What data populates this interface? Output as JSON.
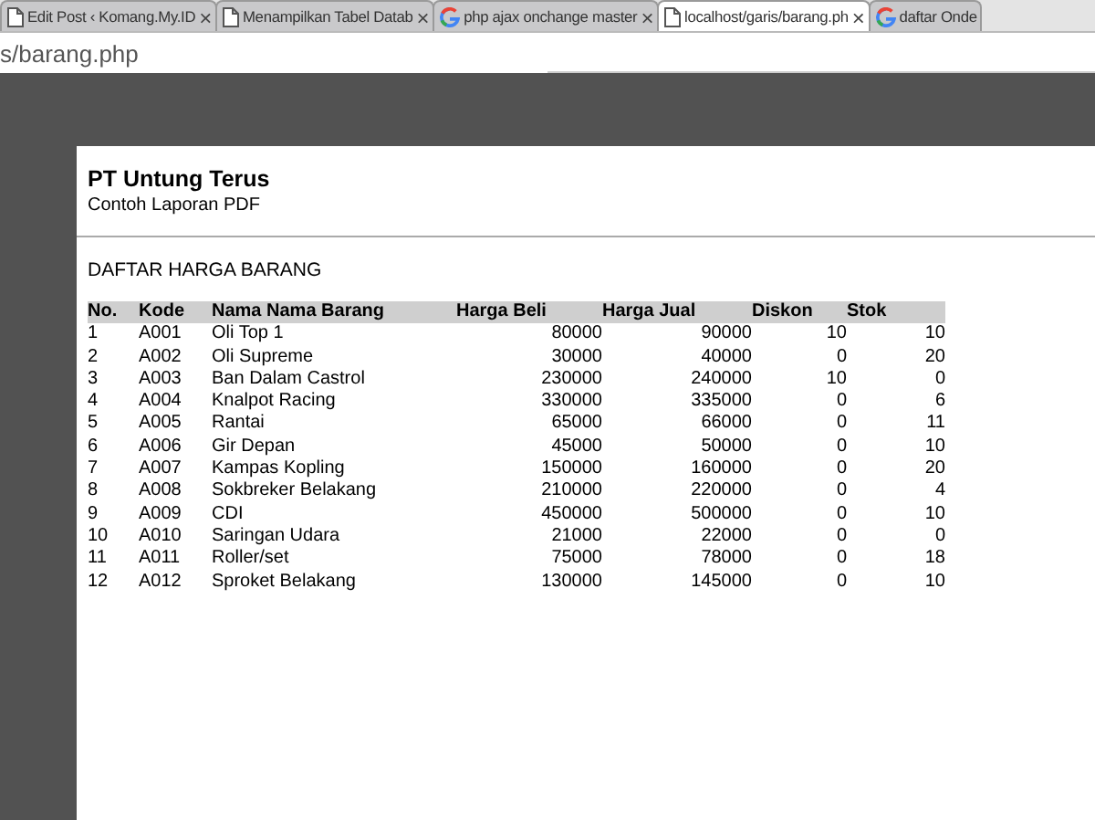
{
  "tabs": [
    {
      "title": "Edit Post ‹ Komang.My.ID",
      "kind": "page",
      "selected": false,
      "close": "×"
    },
    {
      "title": "Menampilkan Tabel Datab",
      "kind": "page",
      "selected": false,
      "close": "×"
    },
    {
      "title": "php ajax onchange master",
      "kind": "google",
      "selected": false,
      "close": "×"
    },
    {
      "title": "localhost/garis/barang.ph",
      "kind": "page",
      "selected": true,
      "close": "×"
    },
    {
      "title": "daftar Onde",
      "kind": "google",
      "selected": false
    }
  ],
  "address_bar": {
    "value": "s/barang.php"
  },
  "document": {
    "company": "PT Untung Terus",
    "subtitle": "Contoh Laporan PDF",
    "heading": "DAFTAR HARGA BARANG",
    "table": {
      "columns": [
        "No.",
        "Kode",
        "Nama Nama Barang",
        "Harga Beli",
        "Harga Jual",
        "Diskon",
        "Stok"
      ],
      "rows": [
        [
          "1",
          "A001",
          "Oli Top 1",
          "80000",
          "90000",
          "10",
          "10"
        ],
        [
          "2",
          "A002",
          "Oli Supreme",
          "30000",
          "40000",
          "0",
          "20"
        ],
        [
          "3",
          "A003",
          "Ban Dalam Castrol",
          "230000",
          "240000",
          "10",
          "0"
        ],
        [
          "4",
          "A004",
          "Knalpot Racing",
          "330000",
          "335000",
          "0",
          "6"
        ],
        [
          "5",
          "A005",
          "Rantai",
          "65000",
          "66000",
          "0",
          "11"
        ],
        [
          "6",
          "A006",
          "Gir Depan",
          "45000",
          "50000",
          "0",
          "10"
        ],
        [
          "7",
          "A007",
          "Kampas Kopling",
          "150000",
          "160000",
          "0",
          "20"
        ],
        [
          "8",
          "A008",
          "Sokbreker Belakang",
          "210000",
          "220000",
          "0",
          "4"
        ],
        [
          "9",
          "A009",
          "CDI",
          "450000",
          "500000",
          "0",
          "10"
        ],
        [
          "10",
          "A010",
          "Saringan Udara",
          "21000",
          "22000",
          "0",
          "0"
        ],
        [
          "11",
          "A011",
          "Roller/set",
          "75000",
          "78000",
          "0",
          "18"
        ],
        [
          "12",
          "A012",
          "Sproket Belakang",
          "130000",
          "145000",
          "0",
          "10"
        ]
      ]
    }
  }
}
